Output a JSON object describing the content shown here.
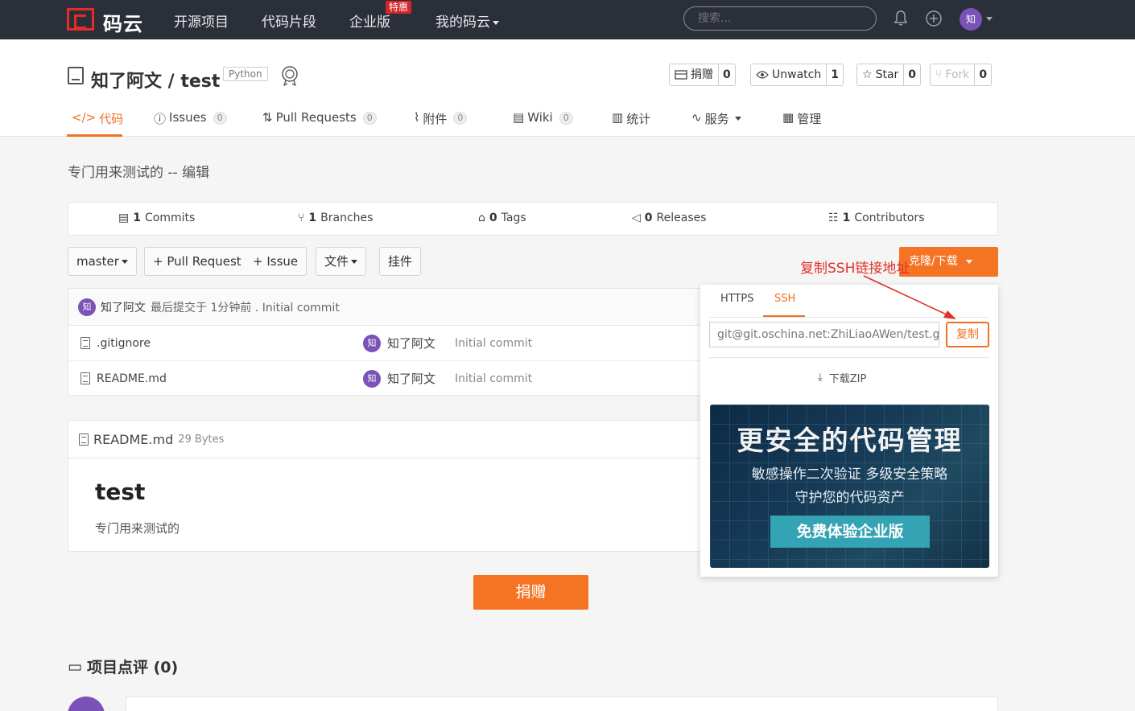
{
  "topnav": {
    "logo_text": "码云",
    "links": [
      "开源项目",
      "代码片段",
      "企业版",
      "我的码云"
    ],
    "special_badge": "特惠",
    "search_placeholder": "搜索...",
    "avatar_char": "知"
  },
  "repo": {
    "title": "知了阿文 / test",
    "language": "Python",
    "actions": [
      {
        "label": "捐赠",
        "count": "0"
      },
      {
        "label": "Unwatch",
        "count": "1"
      },
      {
        "label": "Star",
        "count": "0"
      },
      {
        "label": "Fork",
        "count": "0"
      }
    ],
    "tabs": [
      {
        "label": "代码"
      },
      {
        "label": "Issues",
        "count": "0"
      },
      {
        "label": "Pull Requests",
        "count": "0"
      },
      {
        "label": "附件",
        "count": "0"
      },
      {
        "label": "Wiki",
        "count": "0"
      },
      {
        "label": "统计"
      },
      {
        "label": "服务"
      },
      {
        "label": "管理"
      }
    ],
    "description": "专门用来测试的 -- 编辑"
  },
  "stats": [
    {
      "num": "1",
      "label": "Commits"
    },
    {
      "num": "1",
      "label": "Branches"
    },
    {
      "num": "0",
      "label": "Tags"
    },
    {
      "num": "0",
      "label": "Releases"
    },
    {
      "num": "1",
      "label": "Contributors"
    }
  ],
  "toolbar": {
    "branch": "master",
    "pull_request": "+ Pull Request",
    "issue": "+ Issue",
    "files": "文件",
    "widgets": "挂件",
    "clone": "克隆/下载"
  },
  "annotation": "复制SSH链接地址",
  "files": {
    "commit": {
      "avatar": "知",
      "user": "知了阿文",
      "meta": "最后提交于 1分钟前 . Initial commit"
    },
    "rows": [
      {
        "name": ".gitignore",
        "avatar": "知",
        "user": "知了阿文",
        "message": "Initial commit"
      },
      {
        "name": "README.md",
        "avatar": "知",
        "user": "知了阿文",
        "message": "Initial commit"
      }
    ]
  },
  "readme": {
    "filename": "README.md",
    "size": "29 Bytes",
    "heading": "test",
    "body": "专门用来测试的"
  },
  "donate_label": "捐赠",
  "comments_title": "项目点评 (0)",
  "dropdown": {
    "tabs": [
      "HTTPS",
      "SSH"
    ],
    "active_tab": "SSH",
    "ssh_url": "git@git.oschina.net:ZhiLiaoAWen/test.git",
    "copy_label": "复制",
    "download_zip": "下载ZIP",
    "promo": {
      "title": "更安全的代码管理",
      "line1": "敏感操作二次验证   多级安全策略",
      "line2": "守护您的代码资产",
      "button": "免费体验企业版"
    }
  },
  "colors": {
    "accent": "#f57424",
    "nav_bg": "#2a2f3a",
    "annotation": "#e0312b",
    "avatar": "#7a52b8"
  }
}
